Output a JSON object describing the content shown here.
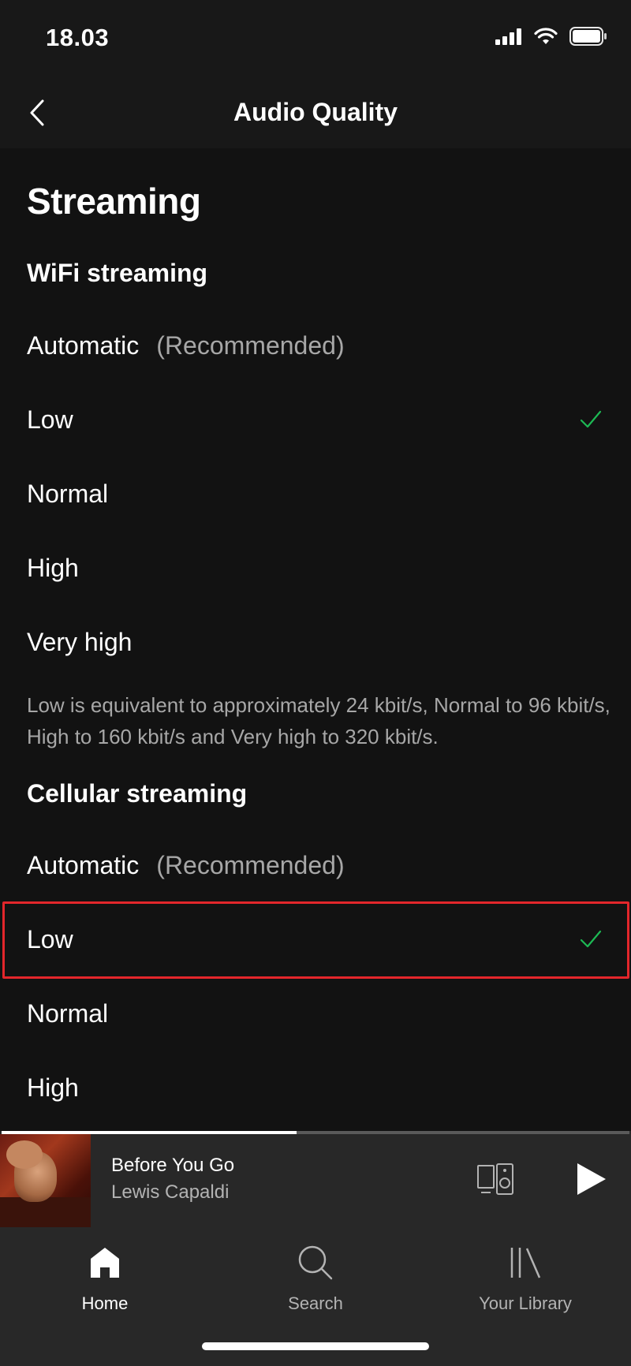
{
  "status_bar": {
    "time": "18.03",
    "icons": [
      "cellular-signal-icon",
      "wifi-icon",
      "battery-icon"
    ]
  },
  "header": {
    "title": "Audio Quality",
    "back_icon": "chevron-left-icon"
  },
  "streaming": {
    "section_title": "Streaming",
    "wifi": {
      "title": "WiFi streaming",
      "options": [
        {
          "label": "Automatic",
          "hint": "(Recommended)",
          "selected": false
        },
        {
          "label": "Low",
          "hint": "",
          "selected": true
        },
        {
          "label": "Normal",
          "hint": "",
          "selected": false
        },
        {
          "label": "High",
          "hint": "",
          "selected": false
        },
        {
          "label": "Very high",
          "hint": "",
          "selected": false
        }
      ],
      "description": "Low is equivalent to approximately 24 kbit/s, Normal to 96 kbit/s, High to 160 kbit/s and Very high to 320 kbit/s."
    },
    "cellular": {
      "title": "Cellular streaming",
      "options": [
        {
          "label": "Automatic",
          "hint": "(Recommended)",
          "selected": false
        },
        {
          "label": "Low",
          "hint": "",
          "selected": true
        },
        {
          "label": "Normal",
          "hint": "",
          "selected": false
        },
        {
          "label": "High",
          "hint": "",
          "selected": false
        }
      ]
    }
  },
  "player": {
    "track_title": "Before You Go",
    "artist": "Lewis Capaldi",
    "progress_fraction": 0.47,
    "devices_icon": "devices-icon",
    "play_icon": "play-icon"
  },
  "tabbar": {
    "tabs": [
      {
        "label": "Home",
        "icon": "home-icon",
        "active": true
      },
      {
        "label": "Search",
        "icon": "search-icon",
        "active": false
      },
      {
        "label": "Your Library",
        "icon": "library-icon",
        "active": false
      }
    ]
  },
  "colors": {
    "background": "#121212",
    "check_green": "#1db954",
    "highlight_red": "#e3262b",
    "secondary_text": "#a7a7a7"
  }
}
